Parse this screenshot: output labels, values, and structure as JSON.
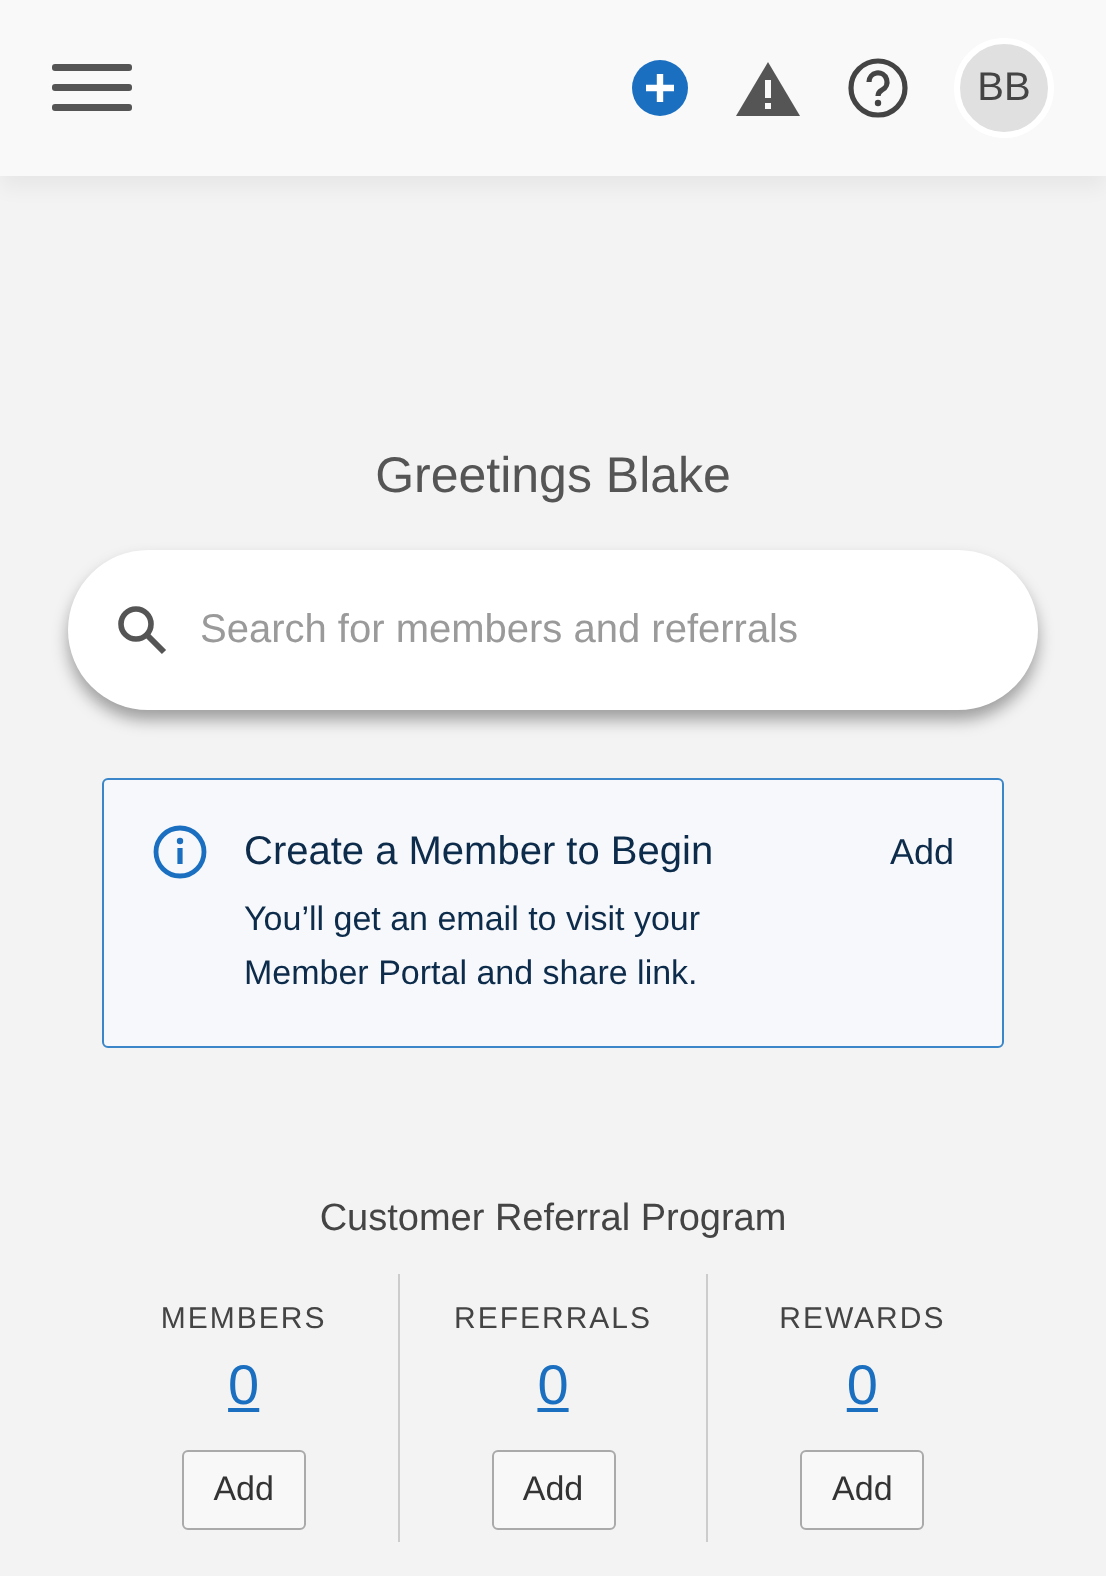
{
  "header": {
    "avatar": "BB"
  },
  "greeting": "Greetings Blake",
  "search": {
    "placeholder": "Search for members and referrals"
  },
  "notice": {
    "title": "Create a Member to Begin",
    "body": "You’ll get an email to visit your Member Portal and share link.",
    "action": "Add"
  },
  "program": {
    "title": "Customer Referral Program",
    "stats": [
      {
        "label": "MEMBERS",
        "value": "0",
        "button": "Add"
      },
      {
        "label": "REFERRALS",
        "value": "0",
        "button": "Add"
      },
      {
        "label": "REWARDS",
        "value": "0",
        "button": "Add"
      }
    ]
  }
}
